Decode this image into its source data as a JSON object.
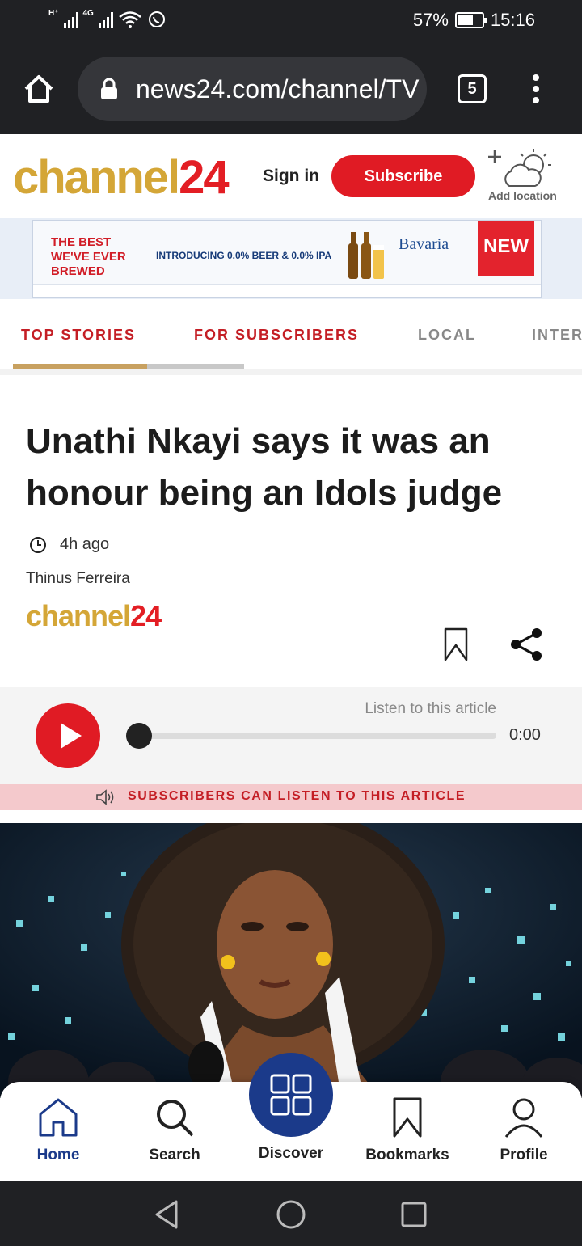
{
  "status_bar": {
    "network_1": "H⁺",
    "network_2": "4G",
    "battery": "57%",
    "time": "15:16"
  },
  "browser": {
    "url": "news24.com/channel/TV",
    "tab_count": "5"
  },
  "header": {
    "logo_part1": "channel",
    "logo_part2": "24",
    "sign_in": "Sign in",
    "subscribe": "Subscribe",
    "add_location": "Add location"
  },
  "ad": {
    "headline": "THE BEST WE'VE EVER BREWED",
    "tagline": "INTRODUCING 0.0% BEER & 0.0% IPA",
    "brand": "Bavaria",
    "badge": "NEW"
  },
  "tabs": [
    {
      "label": "TOP STORIES"
    },
    {
      "label": "FOR SUBSCRIBERS"
    },
    {
      "label": "LOCAL"
    },
    {
      "label": "INTER"
    }
  ],
  "article": {
    "headline": "Unathi Nkayi says it was an honour being an Idols judge",
    "time_ago": "4h ago",
    "author": "Thinus Ferreira",
    "source_part1": "channel",
    "source_part2": "24"
  },
  "audio": {
    "listen_label": "Listen to this article",
    "duration": "0:00",
    "progress": 0,
    "subscribers_note": "SUBSCRIBERS CAN LISTEN TO THIS ARTICLE"
  },
  "bottom_nav": {
    "home": "Home",
    "search": "Search",
    "discover": "Discover",
    "bookmarks": "Bookmarks",
    "profile": "Profile"
  },
  "colors": {
    "brand_red": "#e01b24",
    "brand_gold": "#d4a637",
    "nav_blue": "#1b3a8a"
  }
}
